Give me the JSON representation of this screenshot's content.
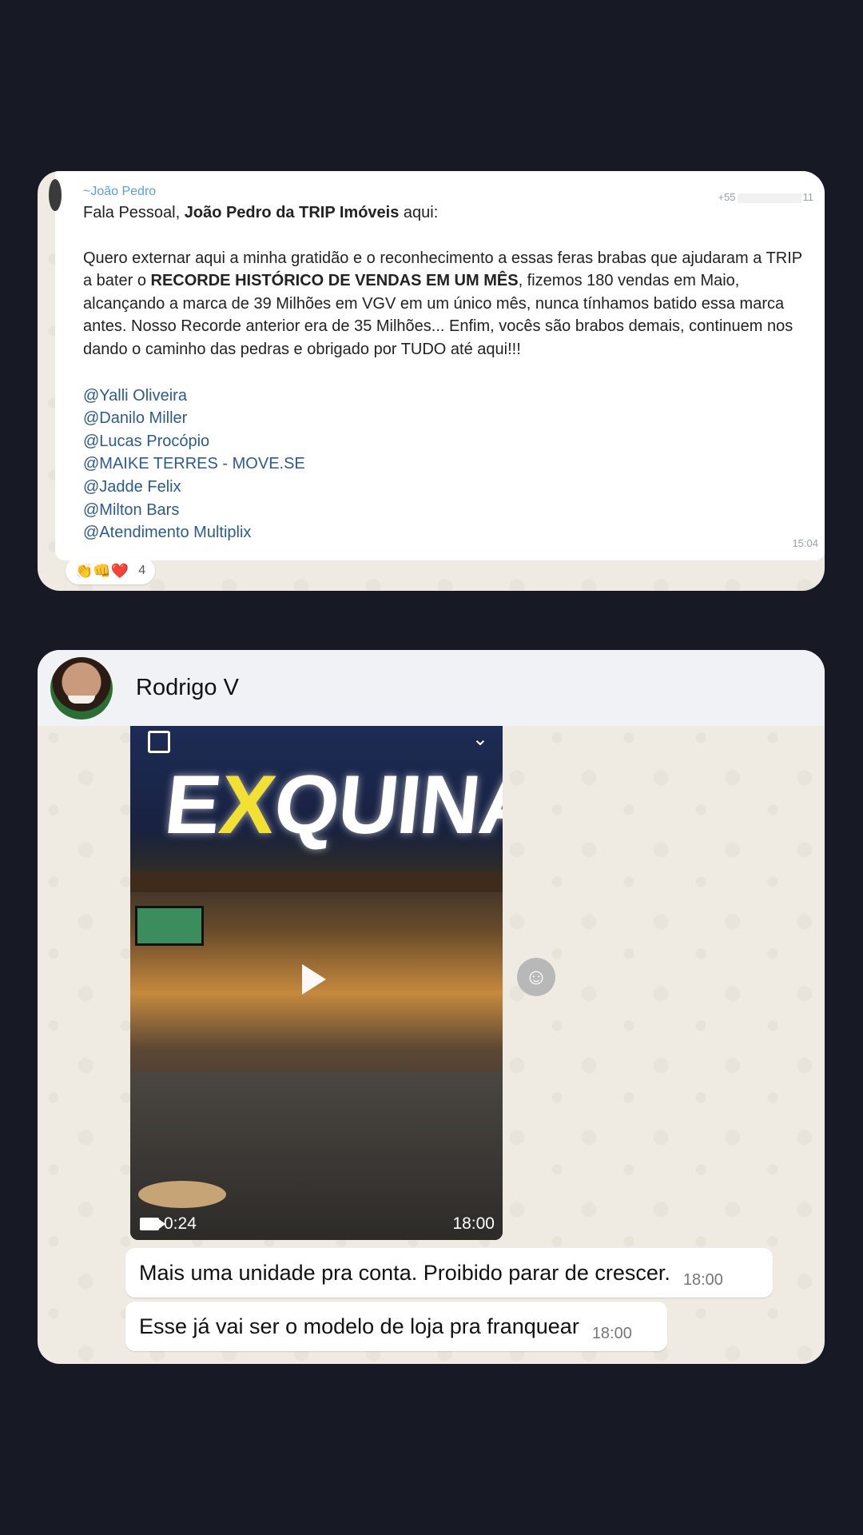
{
  "message1": {
    "sender": "~João Pedro",
    "phone_prefix": "+55",
    "phone_suffix": "11",
    "greeting_prefix": "Fala Pessoal, ",
    "greeting_bold": "João Pedro da TRIP Imóveis",
    "greeting_suffix": " aqui:",
    "body_part1": "Quero externar aqui a minha gratidão e o reconhecimento a essas feras brabas que ajudaram a TRIP a bater o ",
    "body_bold": "RECORDE HISTÓRICO DE VENDAS EM UM MÊS",
    "body_part2": ", fizemos 180 vendas em Maio, alcançando a marca de 39 Milhões em VGV em um único mês, nunca tínhamos batido essa marca antes. Nosso Recorde anterior era de 35 Milhões... Enfim, vocês são brabos demais, continuem nos dando o caminho das pedras e obrigado por TUDO até aqui!!!",
    "mentions": [
      "@Yalli Oliveira",
      "@Danilo Miller",
      "@Lucas Procópio",
      "@MAIKE TERRES - MOVE.SE",
      "@Jadde Felix",
      "@Milton Bars",
      "@Atendimento Multiplix"
    ],
    "time": "15:04",
    "reactions": {
      "emojis": "👏👊❤️",
      "count": "4"
    }
  },
  "chat2": {
    "contact_name": "Rodrigo V",
    "video": {
      "sign_pre": "E",
      "sign_x": "X",
      "sign_post": "QUINA",
      "duration": "0:24",
      "time": "18:00"
    },
    "messages": [
      {
        "text": "Mais uma unidade pra conta.  Proibido parar de crescer.",
        "time": "18:00"
      },
      {
        "text": "Esse já vai ser o modelo de loja pra franquear",
        "time": "18:00"
      }
    ],
    "emoji_button": "☺"
  }
}
